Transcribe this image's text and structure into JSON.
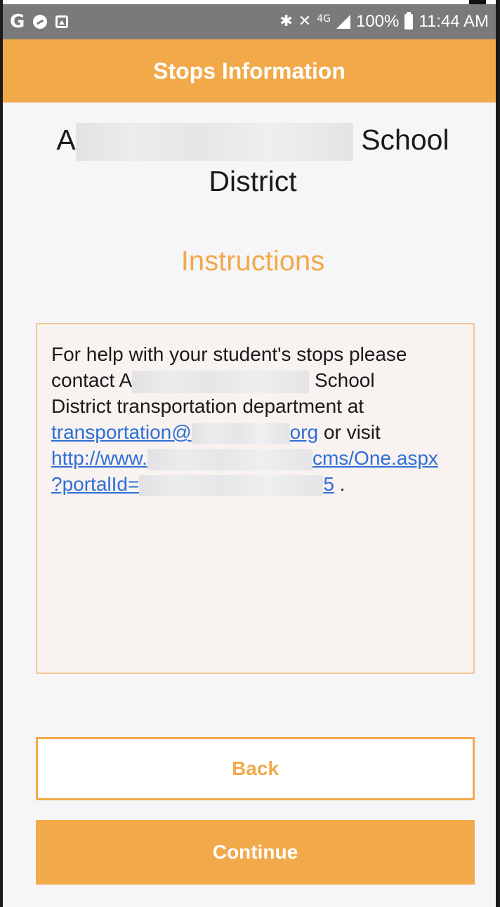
{
  "status_bar": {
    "battery_percent": "100%",
    "time": "11:44 AM",
    "left_icons": [
      "google-icon",
      "circle-block-icon",
      "image-icon"
    ],
    "right_icons": [
      "bluetooth-icon",
      "mute-icon",
      "lte-icon",
      "signal-icon",
      "battery-icon"
    ]
  },
  "header": {
    "title": "Stops Information"
  },
  "district": {
    "name_prefix": "A",
    "name_suffix_line1": "School",
    "name_line2": "District"
  },
  "instructions": {
    "title": "Instructions",
    "text_line1": "For help with your student's stops please",
    "text_line2_prefix": "contact A",
    "text_line2_suffix": "School",
    "text_line3": "District transportation department at",
    "email_link_start": "transportation@",
    "email_link_end": "org",
    "or_visit": " or visit",
    "url_link_start": "http://www.",
    "url_link_end": "cms/One.aspx",
    "url_line2_start": "?portalId=",
    "url_line2_end": "5",
    "trailing": " ."
  },
  "buttons": {
    "back_label": "Back",
    "continue_label": "Continue"
  },
  "colors": {
    "accent": "#f2a94a",
    "link": "#2e6fd6",
    "box_bg": "#f8f2f0",
    "status_bar": "#7a7a7a"
  }
}
